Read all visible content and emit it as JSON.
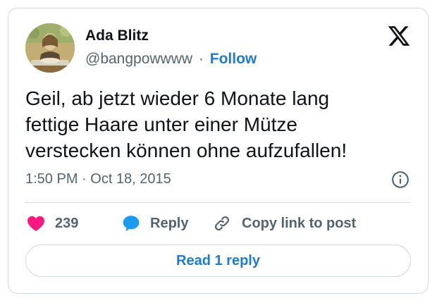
{
  "author": {
    "name": "Ada Blitz",
    "handle": "@bangpowwww",
    "separator": "·",
    "follow_label": "Follow"
  },
  "tweet": {
    "text": "Geil, ab jetzt wieder 6 Monate lang\nfettige Haare unter einer Mütze\nverstecken können ohne aufzufallen!",
    "timestamp": "1:50 PM · Oct 18, 2015"
  },
  "actions": {
    "like_count": "239",
    "reply_label": "Reply",
    "copy_link_label": "Copy link to post"
  },
  "read_replies_label": "Read 1 reply",
  "icons": {
    "logo": "x-logo-icon",
    "info": "info-icon",
    "like": "heart-icon",
    "reply": "speech-bubble-icon",
    "copy": "link-icon"
  },
  "colors": {
    "like": "#f91880",
    "reply": "#1d9bf0",
    "link_text": "#1d7bd1",
    "secondary_text": "#536471",
    "border": "#cfd9de"
  }
}
